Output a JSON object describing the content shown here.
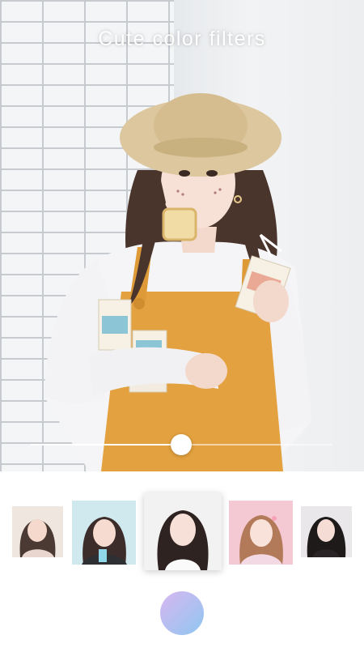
{
  "header": {
    "title": "Cute color filters"
  },
  "editor": {
    "intensity": 0.5
  },
  "filters": {
    "selected_index": 2,
    "items": [
      {
        "name": "filter-1",
        "tint": "#efe6e0"
      },
      {
        "name": "filter-2",
        "tint": "#cfe9ef"
      },
      {
        "name": "filter-3",
        "tint": "#f3f2f2"
      },
      {
        "name": "filter-4",
        "tint": "#f4c9d3"
      },
      {
        "name": "filter-5",
        "tint": "#e9e7ea"
      }
    ]
  },
  "colors": {
    "capture_gradient_start": "#d8b7f1",
    "capture_gradient_end": "#8fc6f0",
    "overall_color": "#e3a13f"
  }
}
